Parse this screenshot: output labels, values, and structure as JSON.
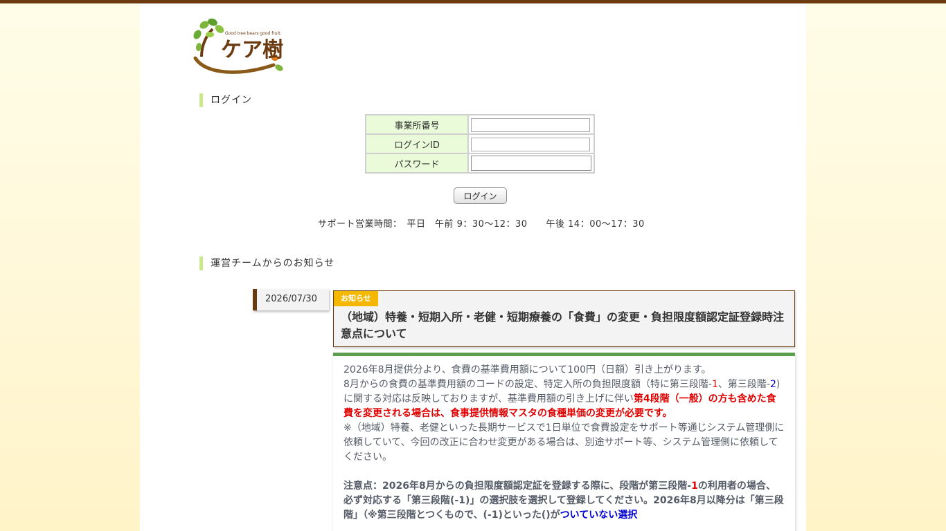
{
  "logo": {
    "tagline": "Good tree bears good fruit.",
    "name": "ケア樹"
  },
  "login": {
    "heading": "ログイン",
    "fields": [
      {
        "label": "事業所番号",
        "value": ""
      },
      {
        "label": "ログインID",
        "value": ""
      },
      {
        "label": "パスワード",
        "value": ""
      }
    ],
    "button": "ログイン"
  },
  "support_hours": "サポート営業時間：　平日　午前 9：30～12：30　　午後 14：00～17：30",
  "notices": {
    "heading": "運営チームからのお知らせ",
    "items": [
      {
        "date": "2026/07/30",
        "badge": "お知らせ",
        "title": "（地域）特養・短期入所・老健・短期療養の「食費」の変更・負担限度額認定証登録時注意点について",
        "body": {
          "p1": "2026年8月提供分より、食費の基準費用額について100円（日額）引き上がります。",
          "p2_a": "8月からの食費の基準費用額のコードの設定、特定入所の負担限度額（特に第三段階-",
          "p2_b": "1",
          "p2_c": "、第三段階-",
          "p2_d": "2",
          "p2_e": ")に関する対応は反映しておりますが、基準費用額の引き上げに伴い",
          "p2_f": "第4段階（一般）の方も含めた食費を変更される場合は、食事提供情報マスタの食種単価の変更が必要です。",
          "p3": "※（地域）特養、老健といった長期サービスで1日単位で食費設定をサポート等通じシステム管理側に依頼していて、今回の改正に合わせ変更がある場合は、別途サポート等、システム管理側に依頼してください。",
          "p4_a": "注意点：2026年8月からの負担限度額認定証を登録する際に、段階が第三段階-",
          "p4_b": "1",
          "p4_c": "の利用者の場合、必ず対応する「第三段階(-1)」の選択肢を選択して登録してください。2026年8月以降分は「第三段階」（※第三段階とつくもので、(-1)といった()が",
          "p4_d": "ついていない選択"
        }
      }
    ]
  }
}
